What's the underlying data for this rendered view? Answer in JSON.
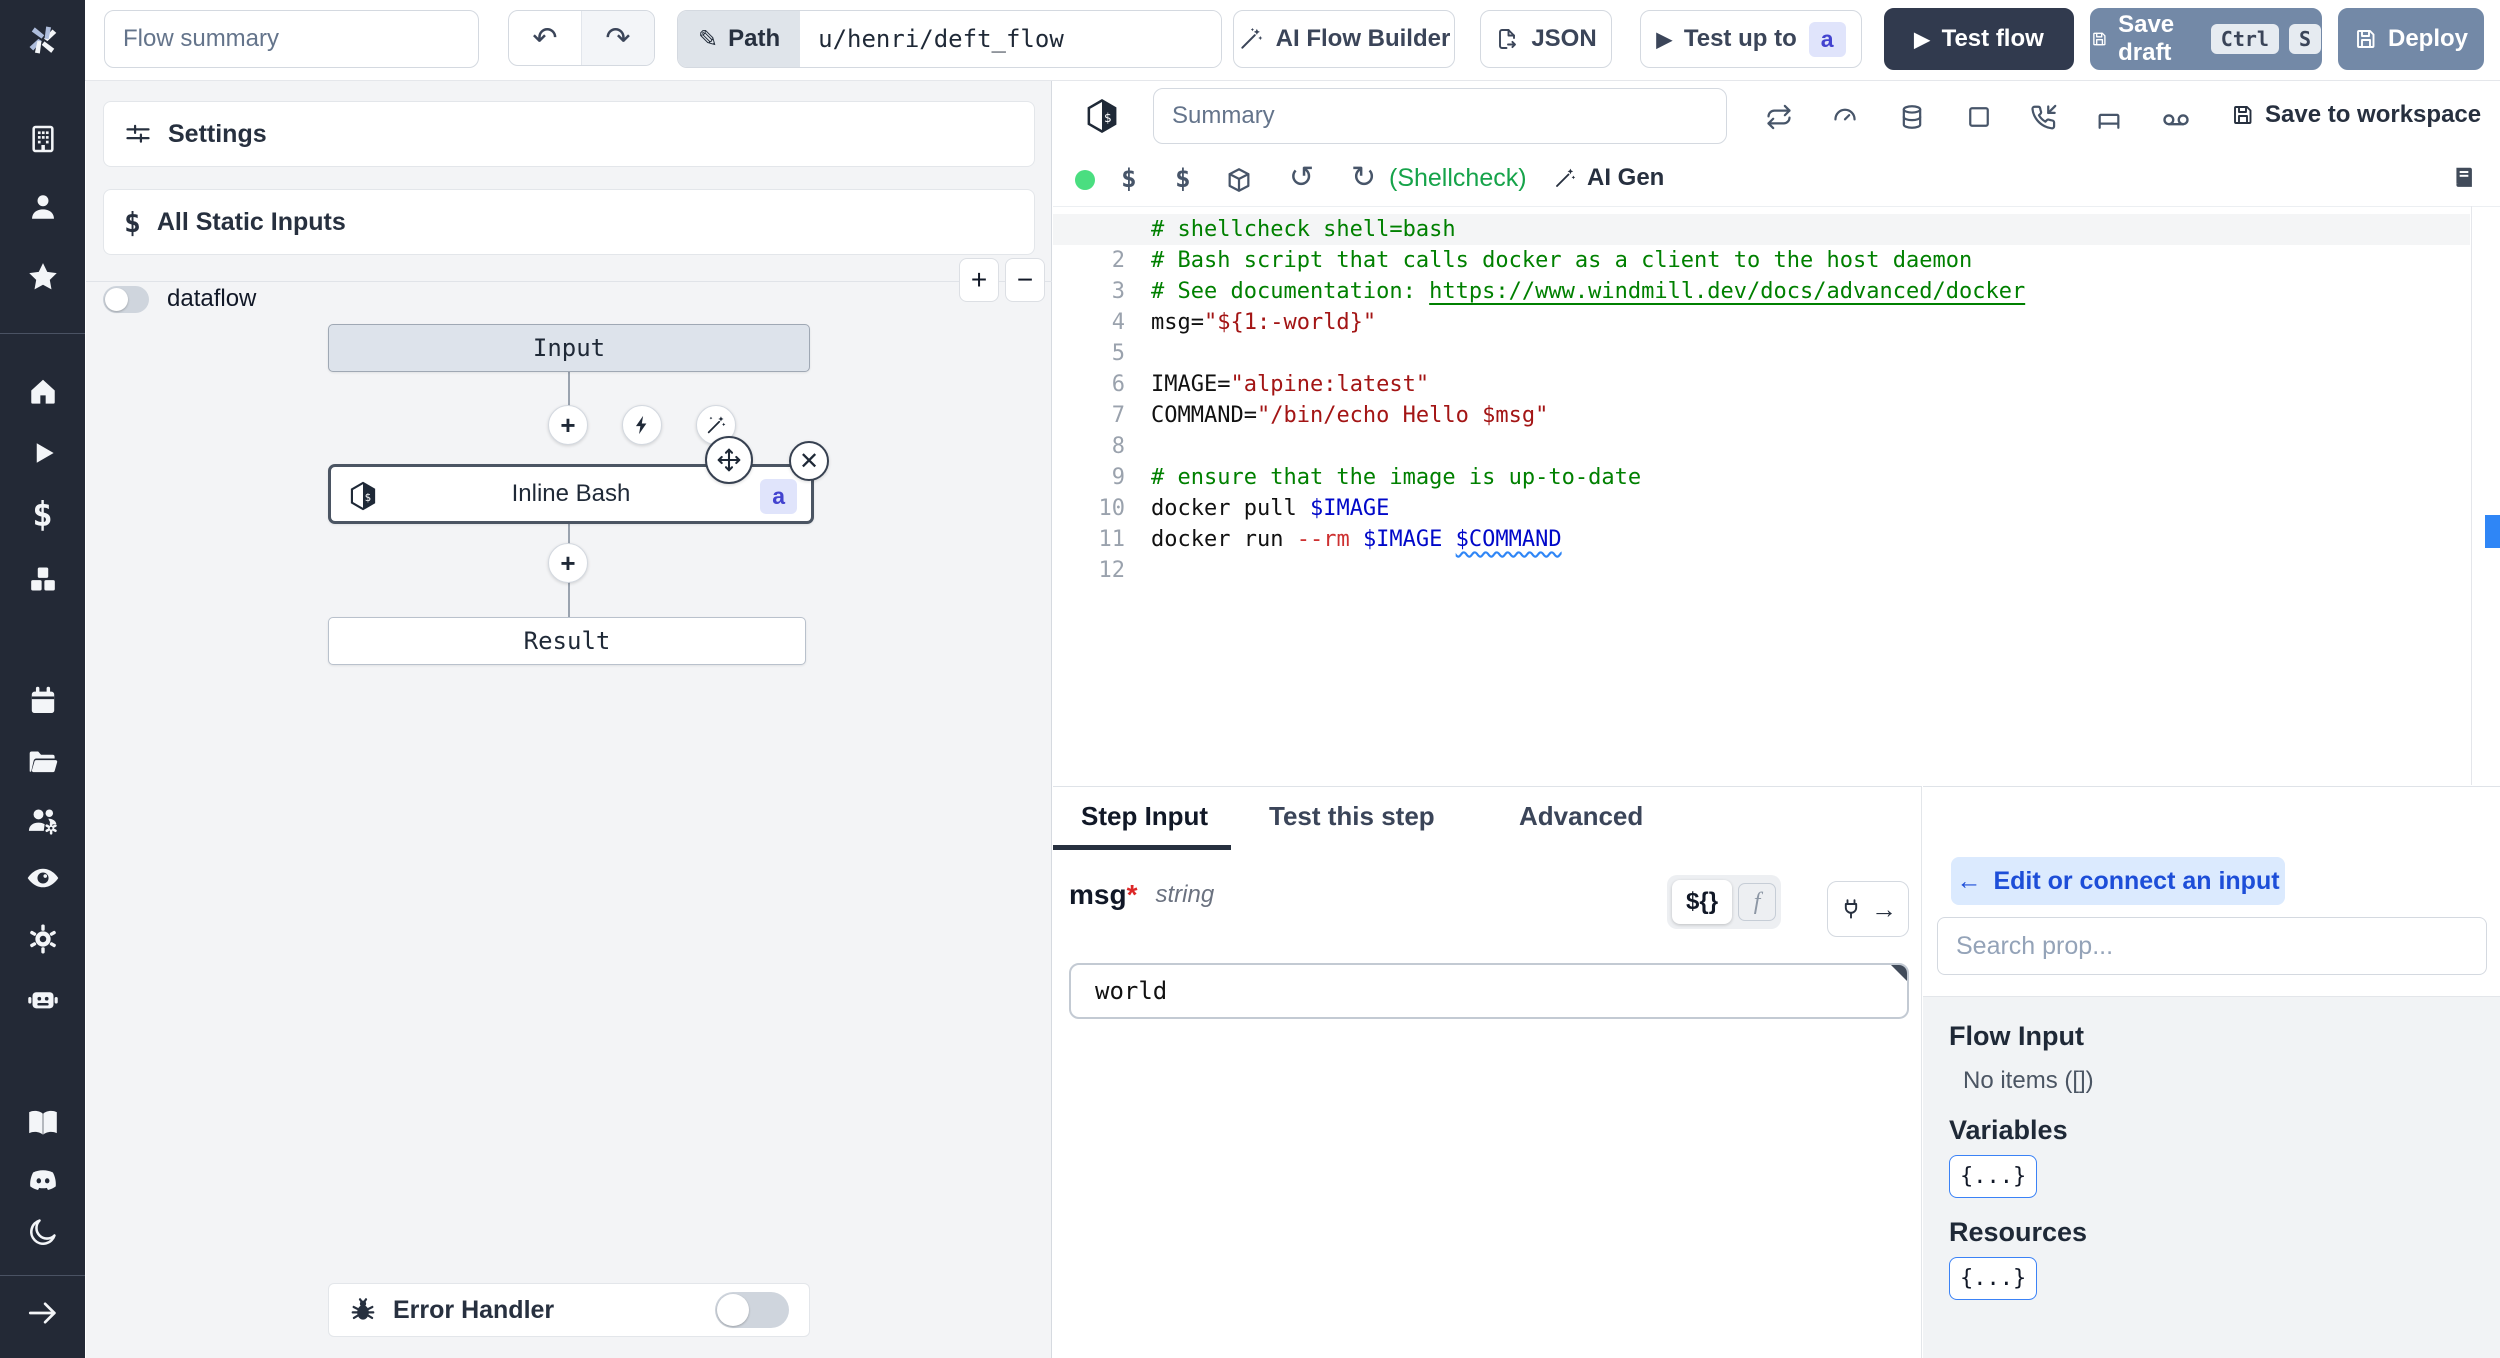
{
  "topbar": {
    "flow_summary_placeholder": "Flow summary",
    "path_label": "Path",
    "path_value": "u/henri/deft_flow",
    "ai_flow_builder": "AI Flow Builder",
    "json_label": "JSON",
    "test_up_to": "Test up to",
    "test_up_to_badge": "a",
    "test_flow": "Test flow",
    "save_draft": "Save draft",
    "kbd_ctrl": "Ctrl",
    "kbd_s": "S",
    "deploy": "Deploy"
  },
  "sidebar": {
    "icons": [
      "windmill-logo",
      "building",
      "user",
      "star",
      "home",
      "play",
      "dollar",
      "cubes",
      "calendar",
      "folder",
      "users-gear",
      "eye",
      "gear",
      "robot",
      "book",
      "discord",
      "moon",
      "arrow-right"
    ]
  },
  "flow_panel": {
    "settings": "Settings",
    "all_static_inputs": "All Static Inputs",
    "dataflow": "dataflow",
    "zoom_in": "+",
    "zoom_out": "−",
    "error_handler": "Error Handler"
  },
  "graph": {
    "input": "Input",
    "step": "Inline Bash",
    "step_badge": "a",
    "result": "Result"
  },
  "editor": {
    "summary_placeholder": "Summary",
    "save_to_workspace": "Save to workspace",
    "header_icons": [
      "repeat",
      "gauge",
      "database",
      "square",
      "phone-incoming",
      "bed",
      "voicemail"
    ],
    "toolbar_icons": [
      "status-dot",
      "dollar",
      "dollar",
      "cube",
      "undo-rotate",
      "refresh"
    ],
    "shellcheck": "(Shellcheck)",
    "ai_gen": "AI Gen",
    "language": "bash",
    "code": [
      [
        {
          "t": "# shellcheck shell=bash",
          "c": "comment"
        }
      ],
      [
        {
          "t": "# Bash script that calls docker as a client to the host daemon",
          "c": "comment"
        }
      ],
      [
        {
          "t": "# See documentation: ",
          "c": "comment"
        },
        {
          "t": "https://www.windmill.dev/docs/advanced/docker",
          "c": "comment-link"
        }
      ],
      [
        {
          "t": "msg=",
          "c": "plain"
        },
        {
          "t": "\"${1:-world}\"",
          "c": "string"
        }
      ],
      [],
      [
        {
          "t": "IMAGE=",
          "c": "plain"
        },
        {
          "t": "\"alpine:latest\"",
          "c": "string"
        }
      ],
      [
        {
          "t": "COMMAND=",
          "c": "plain"
        },
        {
          "t": "\"/bin/echo Hello $msg\"",
          "c": "string"
        }
      ],
      [],
      [
        {
          "t": "# ensure that the image is up-to-date",
          "c": "comment"
        }
      ],
      [
        {
          "t": "docker pull ",
          "c": "plain"
        },
        {
          "t": "$IMAGE",
          "c": "var"
        }
      ],
      [
        {
          "t": "docker run ",
          "c": "plain"
        },
        {
          "t": "--rm",
          "c": "flag"
        },
        {
          "t": " ",
          "c": "plain"
        },
        {
          "t": "$IMAGE",
          "c": "var"
        },
        {
          "t": " ",
          "c": "plain"
        },
        {
          "t": "$COMMAND",
          "c": "var-err"
        }
      ],
      []
    ]
  },
  "step_panel": {
    "tabs": [
      "Step Input",
      "Test this step",
      "Advanced"
    ],
    "active_tab": "Step Input",
    "field": {
      "name": "msg",
      "required": "*",
      "type": "string",
      "value": "world"
    },
    "template_btn": "${}",
    "fn_btn": "f"
  },
  "prop_panel": {
    "edit_connect": "Edit or connect an input",
    "search_placeholder": "Search prop...",
    "flow_input": "Flow Input",
    "no_items": "No items ([])",
    "variables": "Variables",
    "variables_value": "{...}",
    "resources": "Resources",
    "resources_value": "{...}"
  },
  "colors": {
    "sidebar_bg": "#232936",
    "dark_button": "#313a4e",
    "slate_button": "#7389a7",
    "accent_blue": "#2f86f6",
    "badge_indigo_bg": "#e0e4fb",
    "badge_indigo_text": "#4343cf",
    "shellcheck_green": "#16a34a",
    "status_green": "#4ade80",
    "comment_green": "#008000",
    "string_red": "#a31515",
    "variable_blue": "#0008c9"
  }
}
